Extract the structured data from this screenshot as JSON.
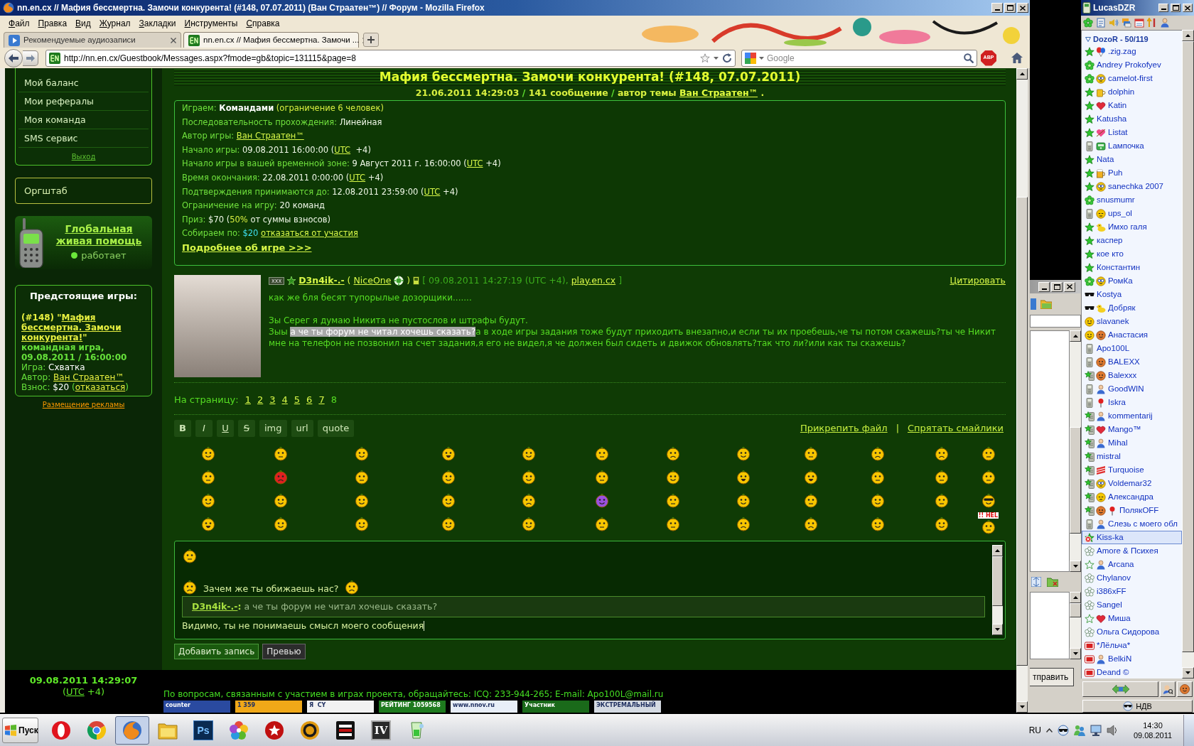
{
  "browser": {
    "title": "nn.en.cx // Мафия бессмертна. Замочи конкурента! (#148, 07.07.2011) (Ван Страатен™) // Форум - Mozilla Firefox",
    "menu": [
      "Файл",
      "Правка",
      "Вид",
      "Журнал",
      "Закладки",
      "Инструменты",
      "Справка"
    ],
    "tabs": [
      {
        "label": "Рекомендуемые аудиозаписи",
        "selected": false
      },
      {
        "label": "nn.en.cx // Мафия бессмертна. Замочи ...",
        "selected": true
      }
    ],
    "url": "http://nn.en.cx/Guestbook/Messages.aspx?fmode=gb&topic=131115&page=8",
    "search": {
      "placeholder": "Google"
    },
    "addon": "ABP"
  },
  "sidebar": {
    "menu": [
      "Мой баланс",
      "Мои рефералы",
      "Моя команда",
      "SMS сервис"
    ],
    "logout": "Выход",
    "staff": "Оргштаб",
    "help": {
      "title": "Глобальная живая помощь",
      "status": "работает",
      "online": true
    },
    "upcoming": {
      "title": "Предстоящие игры:",
      "game": {
        "prefix": "(#148) \"",
        "name": "Мафия бессмертна. Замочи конкурента!",
        "suffix": "\""
      },
      "lines": [
        [
          {
            "kind": "bold",
            "text": "командная игра,"
          }
        ],
        [
          {
            "kind": "bold",
            "text": "09.08.2011 / 16:00:00"
          }
        ],
        [
          {
            "kind": "label",
            "text": "Игра: "
          },
          {
            "kind": "value",
            "text": "Схватка"
          }
        ],
        [
          {
            "kind": "label",
            "text": "Автор: "
          },
          {
            "kind": "link",
            "text": "Ван Страатен™"
          }
        ],
        [
          {
            "kind": "label",
            "text": "Взнос: "
          },
          {
            "kind": "value",
            "text": "$20"
          },
          {
            "kind": "label",
            "text": " ("
          },
          {
            "kind": "link",
            "text": "отказаться"
          },
          {
            "kind": "label",
            "text": ")"
          }
        ]
      ]
    },
    "ads": "Размещение рекламы"
  },
  "topic": {
    "title": "Мафия бессмертна. Замочи конкурента! (#148, 07.07.2011)",
    "meta": [
      {
        "kind": "accent",
        "text": "21.06.2011 14:29:03"
      },
      {
        "kind": "label",
        "text": " / "
      },
      {
        "kind": "accent",
        "text": "141 сообщение"
      },
      {
        "kind": "label",
        "text": " / "
      },
      {
        "kind": "accent",
        "text": "автор темы "
      },
      {
        "kind": "link",
        "text": "Ван Страатен™"
      },
      {
        "kind": "accent",
        "text": " ."
      }
    ]
  },
  "game_info": {
    "lines": [
      [
        {
          "kind": "label",
          "text": "Играем: "
        },
        {
          "kind": "strong",
          "text": "Командами"
        },
        {
          "kind": "accent",
          "text": " (ограничение 6 человек)"
        }
      ],
      [
        {
          "kind": "label",
          "text": "Последовательность прохождения: "
        },
        {
          "kind": "value",
          "text": "Линейная"
        }
      ],
      [
        {
          "kind": "label",
          "text": "Автор игры: "
        },
        {
          "kind": "link",
          "text": "Ван Страатен™"
        }
      ],
      [
        {
          "kind": "label",
          "text": "Начало игры: "
        },
        {
          "kind": "value",
          "text": "09.08.2011 16:00:00 ("
        },
        {
          "kind": "link",
          "text": "UTC"
        },
        {
          "kind": "value",
          "text": "  +4)"
        }
      ],
      [
        {
          "kind": "label",
          "text": "Начало игры в вашей временной зоне: "
        },
        {
          "kind": "value",
          "text": "9 Август 2011 г. 16:00:00 ("
        },
        {
          "kind": "link",
          "text": "UTC"
        },
        {
          "kind": "value",
          "text": " +4)"
        }
      ],
      [
        {
          "kind": "label",
          "text": "Время окончания: "
        },
        {
          "kind": "value",
          "text": "22.08.2011 0:00:00 ("
        },
        {
          "kind": "link",
          "text": "UTC"
        },
        {
          "kind": "value",
          "text": " +4)"
        }
      ],
      [
        {
          "kind": "label",
          "text": "Подтверждения принимаются до: "
        },
        {
          "kind": "value",
          "text": "12.08.2011 23:59:00 ("
        },
        {
          "kind": "link",
          "text": "UTC"
        },
        {
          "kind": "value",
          "text": " +4)"
        }
      ],
      [
        {
          "kind": "label",
          "text": "Ограничение на игру: "
        },
        {
          "kind": "value",
          "text": "20 команд"
        }
      ],
      [
        {
          "kind": "label",
          "text": "Приз: "
        },
        {
          "kind": "value",
          "text": "$70 ("
        },
        {
          "kind": "accent",
          "text": "50%"
        },
        {
          "kind": "value",
          "text": " от суммы взносов)"
        }
      ],
      [
        {
          "kind": "label",
          "text": "Собираем по: "
        },
        {
          "kind": "cyan",
          "text": "$20 "
        },
        {
          "kind": "link",
          "text": "отказаться от участия"
        }
      ],
      [
        {
          "kind": "more",
          "text": "Подробнее об игре >>>"
        }
      ]
    ]
  },
  "post": {
    "rank": "xxx",
    "author": "D3n4ik-.-",
    "open": "(",
    "team": "NiceOne",
    "close": ")",
    "meta": "[ 09.08.2011 14:27:19 (UTC +4),",
    "site": "play.en.cx",
    "meta_end": "]",
    "quote": "Цитировать",
    "body": [
      [
        [
          {
            "text": "как же бля бесят тупорылые дозорщики.......",
            "selected": false
          }
        ]
      ],
      [
        [
          {
            "text": "Зы Серег я думаю Никита не пустослов и штрафы будут.",
            "selected": false
          }
        ],
        [
          {
            "text": "Зыы ",
            "selected": false
          },
          {
            "text": "а че ты форум не читал хочешь сказать?",
            "selected": true
          },
          {
            "text": "а в ходе игры задания тоже будут приходить внезапно,и если ты их проебешь,че ты потом скажешь?ты че Никит мне на телефон не позвонил на счет задания,я его не видел,я че должен был сидеть и движок обновлять?так что ли?или как ты скажешь?",
            "selected": false
          }
        ]
      ]
    ]
  },
  "pager": {
    "label": "На страницу:",
    "pages": [
      {
        "label": "1",
        "selected": false
      },
      {
        "label": "2",
        "selected": false
      },
      {
        "label": "3",
        "selected": false
      },
      {
        "label": "4",
        "selected": false
      },
      {
        "label": "5",
        "selected": false
      },
      {
        "label": "6",
        "selected": false
      },
      {
        "label": "7",
        "selected": false
      },
      {
        "label": "8",
        "selected": true
      }
    ]
  },
  "editor_toolbar": {
    "buttons": [
      {
        "label": "B",
        "kind": "bold"
      },
      {
        "label": "I",
        "kind": "italic"
      },
      {
        "label": "U",
        "kind": "underline"
      },
      {
        "label": "S",
        "kind": "strike"
      },
      {
        "label": "img",
        "kind": "plain"
      },
      {
        "label": "url",
        "kind": "plain"
      },
      {
        "label": "quote",
        "kind": "plain"
      }
    ],
    "links": [
      "Прикрепить файл",
      "Спрятать смайлики"
    ],
    "separator": "|"
  },
  "smiley_sign": "!! HEL",
  "editor": {
    "greeting": "Зачем же ты обижаешь нас?",
    "quote": {
      "author": "D3n4ik-.-",
      "sep": ":",
      "text": " а че ты форум не читал хочешь сказать?"
    },
    "value": "Видимо, ты не понимаешь смысл моего сообщения"
  },
  "form_buttons": [
    "Добавить запись",
    "Превью"
  ],
  "footer": {
    "clock": {
      "time": "09.08.2011 14:29:07",
      "before": "(",
      "utc": "UTC",
      "after": " +4)"
    },
    "contacts": "По вопросам, связанным с участием в играх проекта, обращайтесь: ICQ: 233-944-265; E-mail: Apo100L@mail.ru",
    "banners": [
      {
        "text": "counter",
        "color": "#2a4aa0"
      },
      {
        "text": "1 359",
        "color": "#f0a818"
      },
      {
        "text": "Я  CY",
        "color": "#f2f2f2"
      },
      {
        "text": "РЕЙТИНГ 1059568",
        "color": "#1e7a1e"
      },
      {
        "text": "www.nnov.ru",
        "color": "#e8eef8"
      },
      {
        "text": "Участник",
        "color": "#1a6a1a"
      },
      {
        "text": "ЭКСТРЕМАЛЬНЫЙ",
        "color": "#d4dae2"
      }
    ]
  },
  "chat_window": {
    "send": "тправить"
  },
  "contact_list": {
    "title": "LucasDZR",
    "group": "DozoR - 50/119",
    "expanded": true,
    "contacts": [
      {
        "name": ".zig.zag",
        "kind": "online",
        "badges": [
          {
            "kind": "balloon"
          }
        ],
        "selected": false
      },
      {
        "name": "Andrey Prokofyev",
        "kind": "icq",
        "selected": false
      },
      {
        "name": "camelot-first",
        "kind": "icq",
        "badges": [
          {
            "kind": "nerd"
          }
        ],
        "selected": false
      },
      {
        "name": "dolphin",
        "kind": "online",
        "badges": [
          {
            "kind": "cup"
          }
        ],
        "selected": false
      },
      {
        "name": "Katin",
        "kind": "online",
        "badges": [
          {
            "kind": "heart"
          }
        ],
        "selected": false
      },
      {
        "name": "Katusha",
        "kind": "online",
        "selected": false
      },
      {
        "name": "Listat",
        "kind": "online",
        "badges": [
          {
            "kind": "kiss"
          }
        ],
        "selected": false
      },
      {
        "name": "Lампочка",
        "kind": "mobile",
        "badges": [
          {
            "kind": "phone"
          }
        ],
        "selected": false
      },
      {
        "name": "Nata",
        "kind": "online",
        "selected": false
      },
      {
        "name": "Puh",
        "kind": "online",
        "badges": [
          {
            "kind": "beer"
          }
        ],
        "selected": false
      },
      {
        "name": "sanechka 2007",
        "kind": "online",
        "badges": [
          {
            "kind": "nerd"
          }
        ],
        "selected": false
      },
      {
        "name": "snusmumr",
        "kind": "icq",
        "selected": false
      },
      {
        "name": "ups_ol",
        "kind": "mobile",
        "badges": [
          {
            "kind": "sleepy"
          }
        ],
        "selected": false
      },
      {
        "name": "Имхо галя",
        "kind": "online",
        "badges": [
          {
            "kind": "duck"
          }
        ],
        "selected": false
      },
      {
        "name": "каспер",
        "kind": "online",
        "selected": false
      },
      {
        "name": "кое кто",
        "kind": "online",
        "selected": false
      },
      {
        "name": "Константин",
        "kind": "online",
        "selected": false
      },
      {
        "name": "РомКа",
        "kind": "icq",
        "badges": [
          {
            "kind": "nerd"
          }
        ],
        "selected": false
      },
      {
        "name": "Kostya",
        "kind": "glasses",
        "selected": false
      },
      {
        "name": "Добряк",
        "kind": "glasses",
        "badges": [
          {
            "kind": "duck"
          }
        ],
        "selected": false
      },
      {
        "name": "slavanek",
        "kind": "smile",
        "selected": false
      },
      {
        "name": "Анастасия",
        "kind": "smile",
        "badges": [
          {
            "kind": "brown"
          }
        ],
        "selected": false
      },
      {
        "name": "Apo100L",
        "kind": "mobile",
        "selected": false
      },
      {
        "name": "BALEXX",
        "kind": "mobile",
        "badges": [
          {
            "kind": "brown"
          }
        ],
        "selected": false
      },
      {
        "name": "Balexxx",
        "kind": "online-mobile",
        "badges": [
          {
            "kind": "brown"
          }
        ],
        "selected": false
      },
      {
        "name": "GoodWIN",
        "kind": "mobile",
        "badges": [
          {
            "kind": "person"
          }
        ],
        "selected": false
      },
      {
        "name": "Iskra",
        "kind": "mobile",
        "badges": [
          {
            "kind": "pin"
          }
        ],
        "selected": false
      },
      {
        "name": "kommentarij",
        "kind": "online-mobile",
        "badges": [
          {
            "kind": "person"
          }
        ],
        "selected": false
      },
      {
        "name": "Mango™",
        "kind": "online-mobile",
        "badges": [
          {
            "kind": "heart"
          }
        ],
        "selected": false
      },
      {
        "name": "Mihal",
        "kind": "online-mobile",
        "badges": [
          {
            "kind": "person"
          }
        ],
        "selected": false
      },
      {
        "name": "mistral",
        "kind": "online-mobile",
        "selected": false
      },
      {
        "name": "Turquoise",
        "kind": "online-mobile",
        "badges": [
          {
            "kind": "flag"
          }
        ],
        "selected": false
      },
      {
        "name": "Voldemar32",
        "kind": "online-mobile",
        "badges": [
          {
            "kind": "nerd"
          }
        ],
        "selected": false
      },
      {
        "name": "Александра",
        "kind": "online-mobile",
        "badges": [
          {
            "kind": "sleepy"
          }
        ],
        "selected": false
      },
      {
        "name": "ПолякOFF",
        "kind": "online-mobile",
        "badges": [
          {
            "kind": "brown"
          },
          {
            "kind": "pin"
          }
        ],
        "selected": false
      },
      {
        "name": "Слезь с моего обл",
        "kind": "mobile",
        "badges": [
          {
            "kind": "person"
          }
        ],
        "selected": false
      },
      {
        "name": "Kiss-ka",
        "kind": "dnd",
        "selected": true
      },
      {
        "name": "Amore & Психея",
        "kind": "offline-icq",
        "selected": false
      },
      {
        "name": "Arcana",
        "kind": "offline",
        "badges": [
          {
            "kind": "person"
          }
        ],
        "selected": false
      },
      {
        "name": "Chylanov",
        "kind": "offline-icq",
        "selected": false
      },
      {
        "name": "i386xFF",
        "kind": "offline-icq",
        "selected": false
      },
      {
        "name": "Sangel",
        "kind": "offline-icq",
        "selected": false
      },
      {
        "name": "Миша",
        "kind": "offline",
        "badges": [
          {
            "kind": "heart"
          }
        ],
        "selected": false
      },
      {
        "name": "Ольга Сидорова",
        "kind": "offline-icq",
        "selected": false
      },
      {
        "name": "*Лёльча*",
        "kind": "na",
        "selected": false
      },
      {
        "name": "BelkiN",
        "kind": "na",
        "badges": [
          {
            "kind": "person"
          }
        ],
        "selected": false
      },
      {
        "name": "Deand ©",
        "kind": "na",
        "selected": false
      }
    ],
    "status_label": "НДВ"
  },
  "taskbar": {
    "start": "Пуск",
    "apps": [
      {
        "kind": "opera",
        "active": false
      },
      {
        "kind": "chrome",
        "active": false
      },
      {
        "kind": "firefox",
        "active": true
      },
      {
        "kind": "explorer",
        "active": false
      },
      {
        "kind": "photoshop",
        "label": "Ps",
        "active": false
      },
      {
        "kind": "picasa",
        "active": false
      },
      {
        "kind": "pokerstars",
        "active": false
      },
      {
        "kind": "chip",
        "active": false
      },
      {
        "kind": "fulltilt",
        "active": false
      },
      {
        "kind": "holdem",
        "label": "IV",
        "active": false
      },
      {
        "kind": "glass",
        "active": false
      }
    ],
    "tray": {
      "lang": "RU",
      "time": "14:30",
      "date": "09.08.2011"
    }
  }
}
